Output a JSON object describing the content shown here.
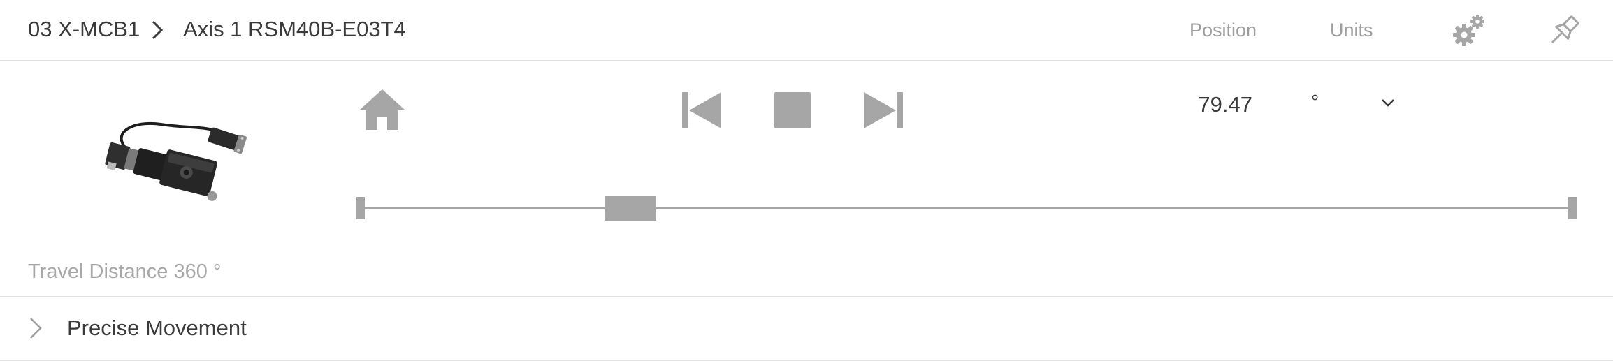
{
  "header": {
    "device": "03 X-MCB1",
    "axis": "Axis 1 RSM40B-E03T4",
    "position_link": "Position",
    "units_link": "Units"
  },
  "controls": {
    "position_value": "79.47",
    "unit_selected": "°"
  },
  "slider": {
    "min": 0,
    "max": 360,
    "value": 79.47
  },
  "travel_distance": "Travel Distance 360 °",
  "precise_movement": {
    "label": "Precise Movement",
    "expanded": false
  },
  "colors": {
    "icon_gray": "#a6a6a6",
    "text_dark": "#3a3a3a",
    "text_muted": "#9e9e9e",
    "divider": "#e0e0e0"
  },
  "icons": {
    "breadcrumb_separator": "chevron-right-icon",
    "settings": "gears-icon",
    "pin": "pin-icon",
    "home": "home-icon",
    "previous": "skip-previous-icon",
    "stop": "stop-icon",
    "next": "skip-next-icon",
    "unit_dropdown": "chevron-down-icon",
    "expander": "chevron-right-icon"
  }
}
